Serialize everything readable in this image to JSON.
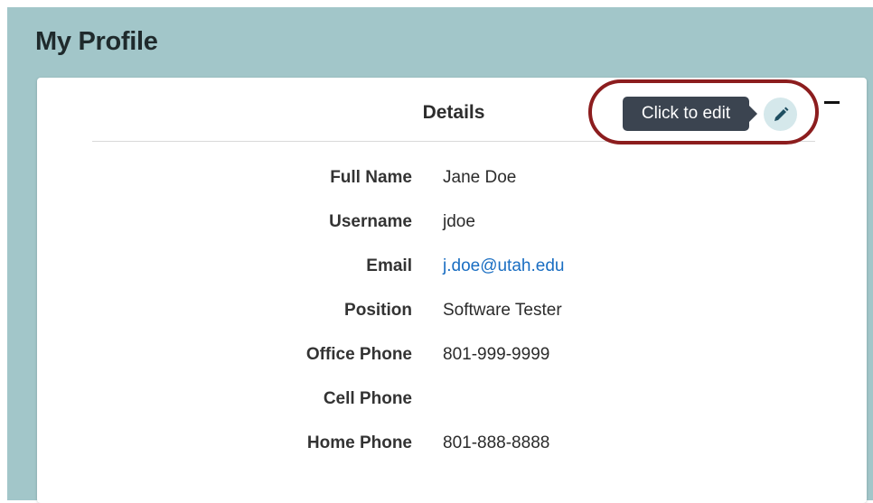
{
  "page": {
    "title": "My Profile"
  },
  "card": {
    "section_title": "Details",
    "tooltip": "Click to edit",
    "edit_icon": "pencil-icon",
    "collapse_icon": "minus-icon"
  },
  "details": [
    {
      "label": "Full Name",
      "value": "Jane Doe"
    },
    {
      "label": "Username",
      "value": "jdoe"
    },
    {
      "label": "Email",
      "value": "j.doe@utah.edu"
    },
    {
      "label": "Position",
      "value": "Software Tester"
    },
    {
      "label": "Office Phone",
      "value": "801-999-9999"
    },
    {
      "label": "Cell Phone",
      "value": ""
    },
    {
      "label": "Home Phone",
      "value": "801-888-8888"
    }
  ],
  "colors": {
    "background": "#a2c6c9",
    "highlight_ring": "#8c1d1e",
    "tooltip_bg": "#3b4450",
    "link": "#1a6ec2",
    "edit_button_bg": "#d5e8eb"
  }
}
